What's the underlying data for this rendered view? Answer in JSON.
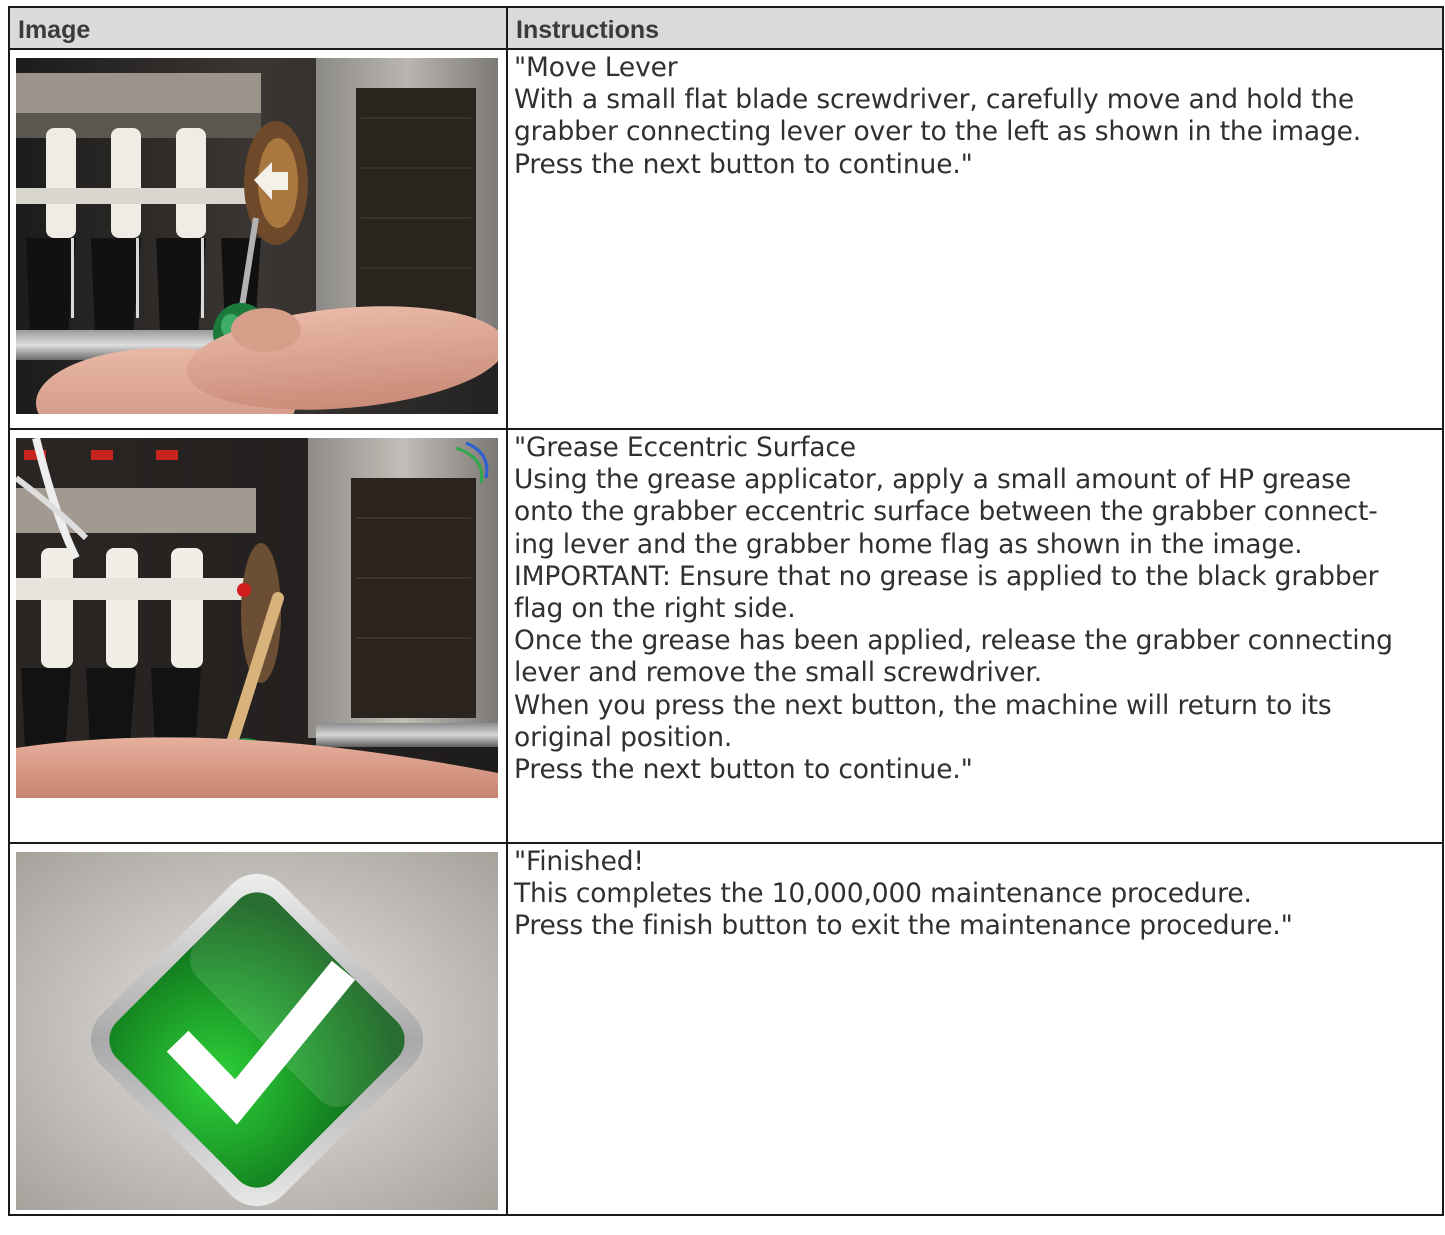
{
  "table": {
    "headers": {
      "image": "Image",
      "instructions": "Instructions"
    },
    "rows": [
      {
        "image_icon": "screwdriver-moving-lever-photo",
        "lines": [
          "\"Move Lever",
          "With a small flat blade screwdriver, carefully move and hold the",
          "grabber connecting lever over to the left as shown in the image.",
          "Press the next button to continue.\""
        ]
      },
      {
        "image_icon": "applying-grease-photo",
        "lines": [
          "\"Grease Eccentric Surface",
          "Using the grease applicator, apply a small amount of HP grease",
          "onto the grabber eccentric surface between the grabber connect-",
          "ing lever and the grabber home flag as shown in the image.",
          "IMPORTANT: Ensure that no grease is applied to the black grabber",
          "flag on the right side.",
          "Once the grease has been applied, release the grabber connecting",
          "lever and remove the small screwdriver.",
          "When you press the next button, the machine will return to its",
          "original position.",
          "Press the next button to continue.\""
        ]
      },
      {
        "image_icon": "green-checkmark-icon",
        "lines": [
          "\"Finished!",
          "This completes the 10,000,000 maintenance procedure.",
          "Press the finish button to exit the maintenance procedure.\""
        ]
      }
    ]
  },
  "colors": {
    "header_bg": "#dadada",
    "border": "#1a1a1a",
    "check_green": "#1f9a2a"
  }
}
